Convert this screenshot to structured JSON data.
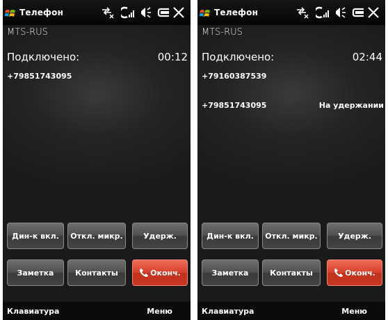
{
  "screens": [
    {
      "app_title": "Телефон",
      "carrier": "MTS-RUS",
      "call_status": "Подключено:",
      "timer": "00:12",
      "calls": [
        {
          "number": "+79851743095",
          "status": ""
        }
      ],
      "buttons": {
        "speaker": "Дин-к вкл.",
        "mute": "Откл. микр.",
        "hold": "Удерж.",
        "note": "Заметка",
        "contacts": "Контакты",
        "end": "Оконч."
      },
      "softkeys": {
        "left": "Клавиатура",
        "right": "Меню"
      }
    },
    {
      "app_title": "Телефон",
      "carrier": "MTS-RUS",
      "call_status": "Подключено:",
      "timer": "02:44",
      "calls": [
        {
          "number": "+79160387539",
          "status": ""
        },
        {
          "number": "+79851743095",
          "status": "На удержании"
        }
      ],
      "buttons": {
        "speaker": "Дин-к вкл.",
        "mute": "Откл. микр.",
        "hold": "Удерж.",
        "note": "Заметка",
        "contacts": "Контакты",
        "end": "Оконч."
      },
      "softkeys": {
        "left": "Клавиатура",
        "right": "Меню"
      }
    }
  ],
  "colors": {
    "end_button": "#d9412b",
    "background": "#1f1f1f"
  },
  "icons": [
    "windows-flag-icon",
    "connectivity-icon",
    "signal-icon",
    "volume-icon",
    "battery-icon",
    "close-icon",
    "phone-end-icon"
  ]
}
